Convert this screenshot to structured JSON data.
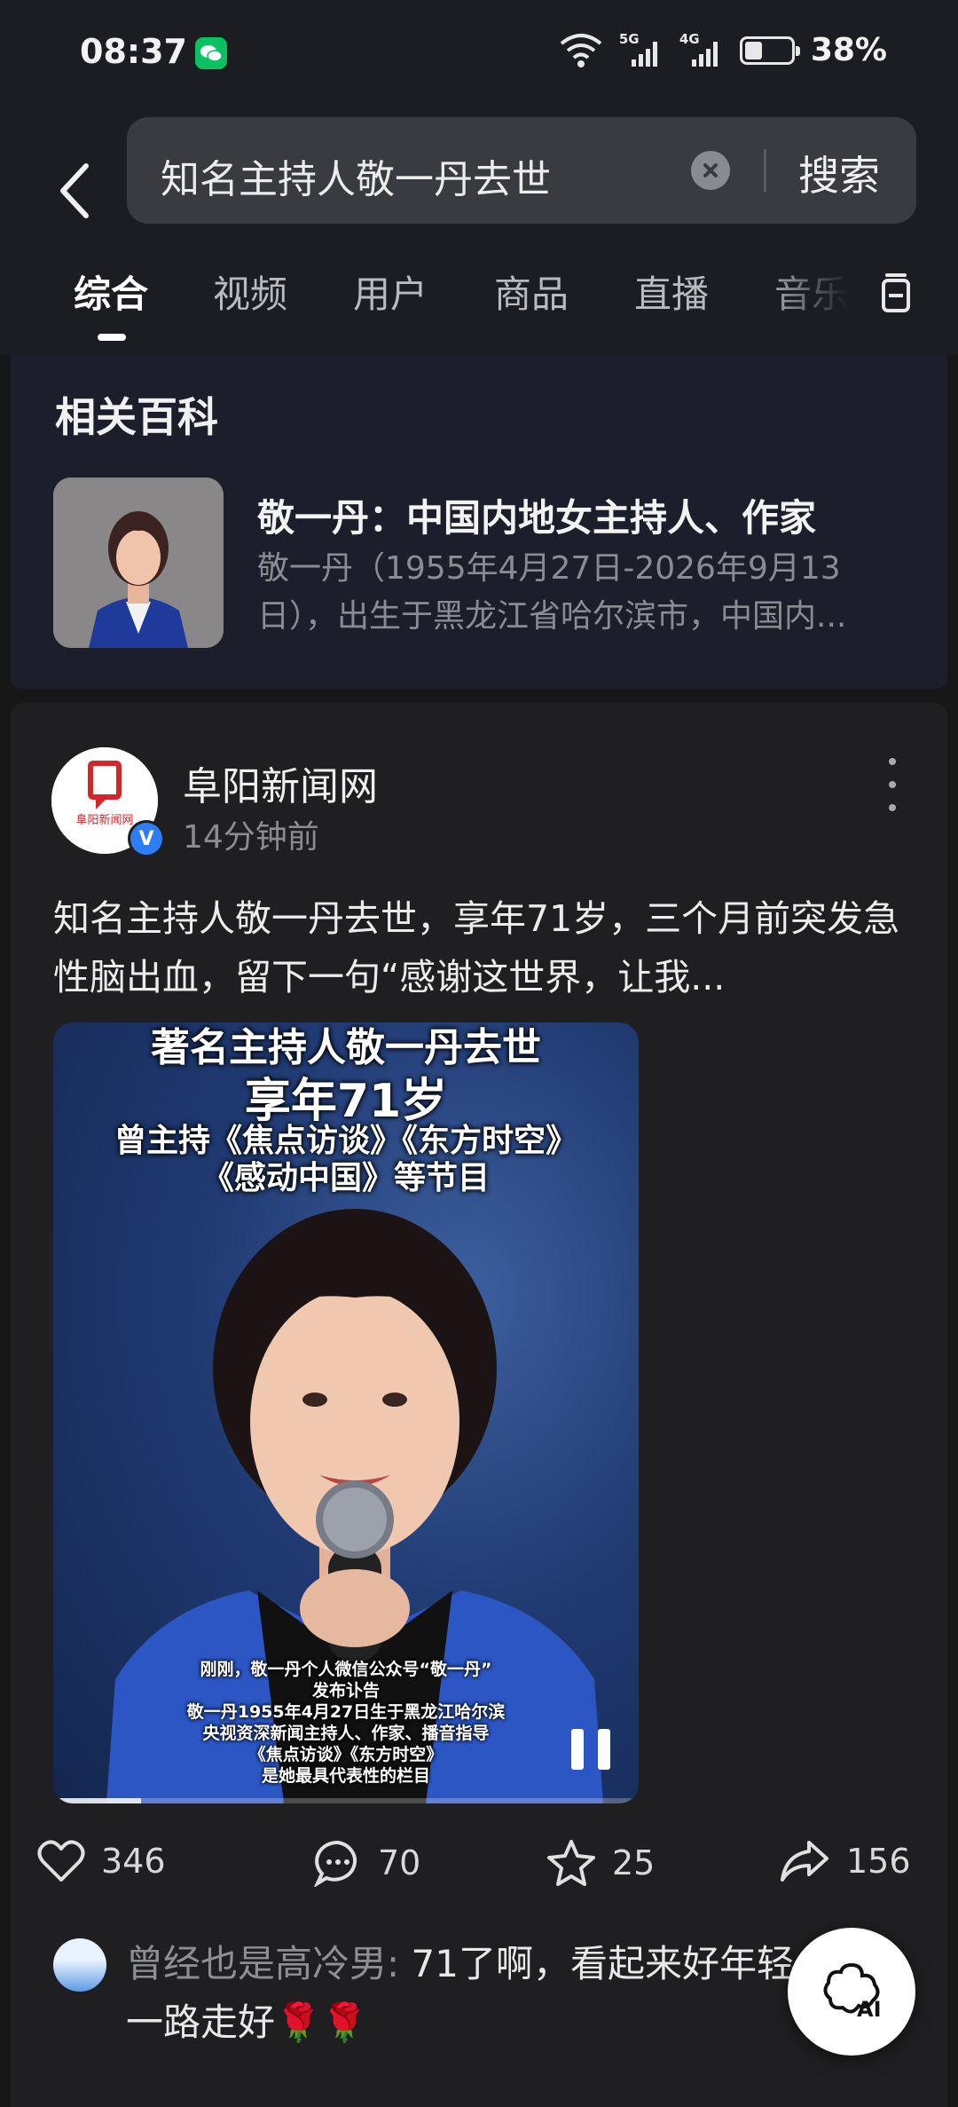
{
  "status_bar": {
    "time": "08:37",
    "network1": "5G",
    "network2": "4G",
    "battery_percent": "38%",
    "battery_level": 0.38
  },
  "search": {
    "query": "知名主持人敬一丹去世",
    "button_label": "搜索"
  },
  "tabs": [
    {
      "label": "综合",
      "active": true
    },
    {
      "label": "视频",
      "active": false
    },
    {
      "label": "用户",
      "active": false
    },
    {
      "label": "商品",
      "active": false
    },
    {
      "label": "直播",
      "active": false
    },
    {
      "label": "音乐",
      "active": false
    }
  ],
  "baike": {
    "section_title": "相关百科",
    "entry_title": "敬一丹：中国内地女主持人、作家",
    "entry_desc": "敬一丹（1955年4月27日-2026年9月13日），出生于黑龙江省哈尔滨市，中国内..."
  },
  "post": {
    "author": "阜阳新闻网",
    "time": "14分钟前",
    "avatar_logo_text": "阜阳新闻网",
    "text": "知名主持人敬一丹去世，享年71岁，三个月前突发急性脑出血，留下一句“感谢这世界，让我...",
    "video": {
      "caption_top": "著名主持人敬一丹去世",
      "caption_age": "享年71岁",
      "caption_programs1": "曾主持《焦点访谈》《东方时空》",
      "caption_programs2": "《感动中国》等节目",
      "subtitles": [
        "刚刚，敬一丹个人微信公众号“敬一丹”",
        "发布讣告",
        "敬一丹1955年4月27日生于黑龙江哈尔滨",
        "央视资深新闻主持人、作家、播音指导",
        "《焦点访谈》《东方时空》",
        "是她最具代表性的栏目"
      ],
      "progress": 0.15
    },
    "likes": "346",
    "comments": "70",
    "favorites": "25",
    "shares": "156"
  },
  "comment_preview": {
    "user": "曾经也是高冷男:",
    "text": " 71了啊，看起来好年轻，一路走好🌹🌹"
  },
  "ai_button": "AI"
}
